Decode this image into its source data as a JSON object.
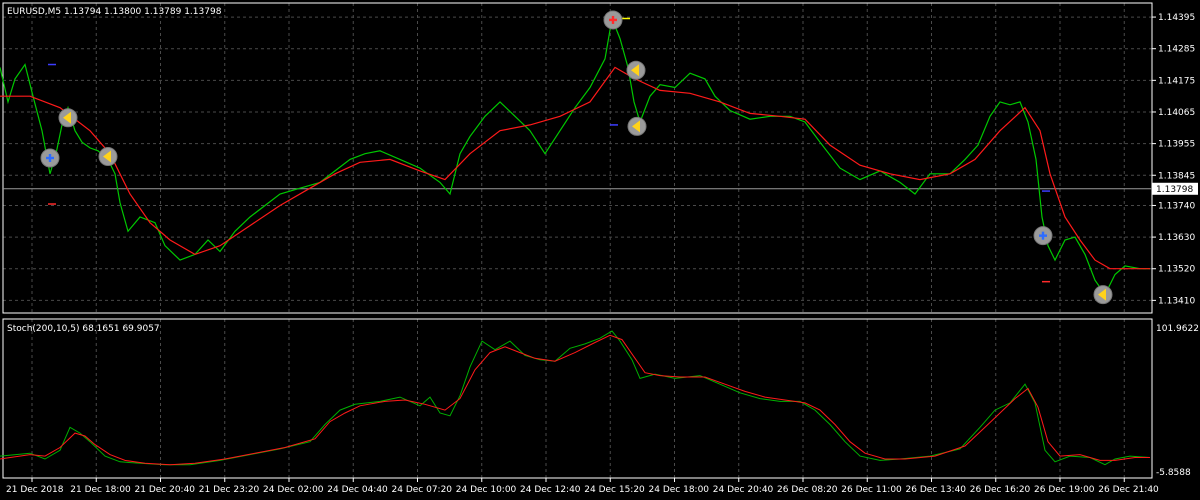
{
  "chart_data": {
    "type": "line",
    "symbol_label": "EURUSD,M5  1.13794 1.13800 1.13789 1.13798",
    "bid_line_label": "1.13798",
    "price_axis_ticks": [
      "1.14395",
      "1.14285",
      "1.14175",
      "1.14065",
      "1.13955",
      "1.13845",
      "1.13740",
      "1.13630",
      "1.13520",
      "1.13410"
    ],
    "price_range": [
      1.1338,
      1.1443
    ],
    "bid_price": 1.13798,
    "x_ticks": [
      "21 Dec 2018",
      "21 Dec 18:00",
      "21 Dec 20:40",
      "21 Dec 23:20",
      "24 Dec 02:00",
      "24 Dec 04:40",
      "24 Dec 07:20",
      "24 Dec 10:00",
      "24 Dec 12:40",
      "24 Dec 15:20",
      "24 Dec 18:00",
      "24 Dec 20:40",
      "26 Dec 08:20",
      "26 Dec 11:00",
      "26 Dec 13:40",
      "26 Dec 16:20",
      "26 Dec 19:00",
      "26 Dec 21:40"
    ],
    "x_range": [
      0,
      1150
    ],
    "price_path": [
      [
        0,
        1.1422
      ],
      [
        8,
        1.141
      ],
      [
        15,
        1.1418
      ],
      [
        25,
        1.1423
      ],
      [
        33,
        1.1412
      ],
      [
        42,
        1.14
      ],
      [
        50,
        1.1385
      ],
      [
        56,
        1.1392
      ],
      [
        62,
        1.1402
      ],
      [
        68,
        1.1408
      ],
      [
        75,
        1.14
      ],
      [
        82,
        1.1396
      ],
      [
        90,
        1.1394
      ],
      [
        98,
        1.1393
      ],
      [
        108,
        1.139
      ],
      [
        115,
        1.1385
      ],
      [
        120,
        1.1375
      ],
      [
        128,
        1.1365
      ],
      [
        140,
        1.137
      ],
      [
        155,
        1.1368
      ],
      [
        165,
        1.136
      ],
      [
        180,
        1.1355
      ],
      [
        195,
        1.1357
      ],
      [
        208,
        1.1362
      ],
      [
        220,
        1.1358
      ],
      [
        235,
        1.1365
      ],
      [
        250,
        1.137
      ],
      [
        265,
        1.1374
      ],
      [
        280,
        1.1378
      ],
      [
        300,
        1.138
      ],
      [
        320,
        1.1382
      ],
      [
        335,
        1.1386
      ],
      [
        350,
        1.139
      ],
      [
        365,
        1.1392
      ],
      [
        380,
        1.1393
      ],
      [
        400,
        1.139
      ],
      [
        420,
        1.1387
      ],
      [
        440,
        1.1382
      ],
      [
        450,
        1.1378
      ],
      [
        460,
        1.1392
      ],
      [
        470,
        1.1398
      ],
      [
        485,
        1.1405
      ],
      [
        500,
        1.141
      ],
      [
        515,
        1.1405
      ],
      [
        530,
        1.14
      ],
      [
        545,
        1.1392
      ],
      [
        560,
        1.14
      ],
      [
        575,
        1.1408
      ],
      [
        590,
        1.1415
      ],
      [
        605,
        1.1425
      ],
      [
        612,
        1.1439
      ],
      [
        620,
        1.1432
      ],
      [
        628,
        1.1422
      ],
      [
        634,
        1.141
      ],
      [
        640,
        1.1403
      ],
      [
        650,
        1.1412
      ],
      [
        660,
        1.1416
      ],
      [
        675,
        1.1415
      ],
      [
        690,
        1.142
      ],
      [
        705,
        1.1418
      ],
      [
        715,
        1.1412
      ],
      [
        730,
        1.1407
      ],
      [
        750,
        1.1404
      ],
      [
        770,
        1.1405
      ],
      [
        790,
        1.1405
      ],
      [
        805,
        1.1403
      ],
      [
        820,
        1.1396
      ],
      [
        840,
        1.1387
      ],
      [
        860,
        1.1383
      ],
      [
        880,
        1.1386
      ],
      [
        900,
        1.1382
      ],
      [
        915,
        1.1378
      ],
      [
        930,
        1.1385
      ],
      [
        950,
        1.1385
      ],
      [
        965,
        1.139
      ],
      [
        978,
        1.1395
      ],
      [
        990,
        1.1405
      ],
      [
        1000,
        1.141
      ],
      [
        1010,
        1.1409
      ],
      [
        1020,
        1.141
      ],
      [
        1028,
        1.1403
      ],
      [
        1036,
        1.139
      ],
      [
        1042,
        1.137
      ],
      [
        1048,
        1.136
      ],
      [
        1055,
        1.1355
      ],
      [
        1065,
        1.1362
      ],
      [
        1075,
        1.1363
      ],
      [
        1085,
        1.1357
      ],
      [
        1095,
        1.1348
      ],
      [
        1105,
        1.1343
      ],
      [
        1115,
        1.135
      ],
      [
        1125,
        1.1353
      ],
      [
        1140,
        1.1352
      ],
      [
        1150,
        1.1352
      ]
    ],
    "ma_path": [
      [
        0,
        1.1412
      ],
      [
        30,
        1.1412
      ],
      [
        60,
        1.1408
      ],
      [
        90,
        1.14
      ],
      [
        110,
        1.1392
      ],
      [
        130,
        1.1378
      ],
      [
        150,
        1.1368
      ],
      [
        170,
        1.1362
      ],
      [
        195,
        1.1357
      ],
      [
        220,
        1.136
      ],
      [
        250,
        1.1367
      ],
      [
        280,
        1.1374
      ],
      [
        310,
        1.138
      ],
      [
        335,
        1.1385
      ],
      [
        360,
        1.1389
      ],
      [
        390,
        1.139
      ],
      [
        420,
        1.1386
      ],
      [
        445,
        1.1383
      ],
      [
        470,
        1.1392
      ],
      [
        500,
        1.14
      ],
      [
        530,
        1.1402
      ],
      [
        560,
        1.1405
      ],
      [
        590,
        1.141
      ],
      [
        615,
        1.1422
      ],
      [
        635,
        1.1418
      ],
      [
        660,
        1.1414
      ],
      [
        690,
        1.1413
      ],
      [
        720,
        1.141
      ],
      [
        750,
        1.1406
      ],
      [
        780,
        1.1405
      ],
      [
        805,
        1.1404
      ],
      [
        830,
        1.1395
      ],
      [
        860,
        1.1388
      ],
      [
        890,
        1.1385
      ],
      [
        920,
        1.1383
      ],
      [
        950,
        1.1385
      ],
      [
        975,
        1.139
      ],
      [
        1000,
        1.14
      ],
      [
        1025,
        1.1408
      ],
      [
        1040,
        1.14
      ],
      [
        1050,
        1.1385
      ],
      [
        1065,
        1.137
      ],
      [
        1080,
        1.1362
      ],
      [
        1095,
        1.1355
      ],
      [
        1110,
        1.1352
      ],
      [
        1130,
        1.1352
      ],
      [
        1150,
        1.1352
      ]
    ],
    "signals": [
      {
        "x": 50,
        "price": 1.13905,
        "kind": "buy"
      },
      {
        "x": 68,
        "price": 1.14045,
        "kind": "close"
      },
      {
        "x": 108,
        "price": 1.1391,
        "kind": "close"
      },
      {
        "x": 613,
        "price": 1.14385,
        "kind": "sell"
      },
      {
        "x": 636,
        "price": 1.1421,
        "kind": "close"
      },
      {
        "x": 637,
        "price": 1.14015,
        "kind": "close"
      },
      {
        "x": 1043,
        "price": 1.13635,
        "kind": "buy"
      },
      {
        "x": 1103,
        "price": 1.1343,
        "kind": "close"
      }
    ],
    "stop_marks": [
      {
        "x": 52,
        "price": 1.1423,
        "color": "#3c3cff"
      },
      {
        "x": 52,
        "price": 1.13745,
        "color": "#ff2a2a"
      },
      {
        "x": 626,
        "price": 1.1439,
        "color": "#ffff00"
      },
      {
        "x": 614,
        "price": 1.1402,
        "color": "#3c3cff"
      },
      {
        "x": 1046,
        "price": 1.1379,
        "color": "#3c3cff"
      },
      {
        "x": 1046,
        "price": 1.13475,
        "color": "#ff2a2a"
      }
    ],
    "stoch_label": "Stoch(200,10,5) 68.1651 69.9057",
    "stoch_axis_top": "101.9622",
    "stoch_axis_bottom": "-5.8588",
    "stoch_range": [
      -5.8588,
      101.9622
    ],
    "stoch_main": [
      [
        0,
        8
      ],
      [
        30,
        10
      ],
      [
        45,
        6
      ],
      [
        60,
        12
      ],
      [
        70,
        28
      ],
      [
        80,
        24
      ],
      [
        90,
        18
      ],
      [
        105,
        8
      ],
      [
        120,
        4
      ],
      [
        140,
        3
      ],
      [
        165,
        2
      ],
      [
        190,
        2
      ],
      [
        220,
        5
      ],
      [
        250,
        9
      ],
      [
        280,
        13
      ],
      [
        310,
        18
      ],
      [
        325,
        30
      ],
      [
        340,
        40
      ],
      [
        355,
        44
      ],
      [
        380,
        46
      ],
      [
        400,
        49
      ],
      [
        420,
        43
      ],
      [
        430,
        49
      ],
      [
        440,
        38
      ],
      [
        450,
        36
      ],
      [
        460,
        50
      ],
      [
        470,
        70
      ],
      [
        482,
        88
      ],
      [
        495,
        82
      ],
      [
        510,
        88
      ],
      [
        525,
        78
      ],
      [
        540,
        75
      ],
      [
        555,
        74
      ],
      [
        570,
        83
      ],
      [
        585,
        86
      ],
      [
        600,
        90
      ],
      [
        612,
        95
      ],
      [
        620,
        88
      ],
      [
        632,
        75
      ],
      [
        640,
        62
      ],
      [
        655,
        65
      ],
      [
        675,
        62
      ],
      [
        700,
        64
      ],
      [
        720,
        58
      ],
      [
        740,
        52
      ],
      [
        760,
        48
      ],
      [
        780,
        46
      ],
      [
        800,
        46
      ],
      [
        815,
        40
      ],
      [
        830,
        30
      ],
      [
        845,
        18
      ],
      [
        860,
        8
      ],
      [
        880,
        5
      ],
      [
        900,
        6
      ],
      [
        930,
        8
      ],
      [
        960,
        13
      ],
      [
        980,
        28
      ],
      [
        995,
        40
      ],
      [
        1010,
        45
      ],
      [
        1025,
        58
      ],
      [
        1035,
        45
      ],
      [
        1045,
        12
      ],
      [
        1055,
        4
      ],
      [
        1070,
        8
      ],
      [
        1090,
        7
      ],
      [
        1105,
        2
      ],
      [
        1115,
        6
      ],
      [
        1130,
        8
      ],
      [
        1150,
        7
      ]
    ],
    "stoch_signal": [
      [
        0,
        6
      ],
      [
        30,
        9
      ],
      [
        45,
        8
      ],
      [
        60,
        14
      ],
      [
        75,
        24
      ],
      [
        85,
        22
      ],
      [
        95,
        16
      ],
      [
        110,
        9
      ],
      [
        125,
        5
      ],
      [
        145,
        3
      ],
      [
        170,
        2
      ],
      [
        195,
        3
      ],
      [
        225,
        6
      ],
      [
        255,
        10
      ],
      [
        285,
        14
      ],
      [
        315,
        20
      ],
      [
        330,
        32
      ],
      [
        345,
        38
      ],
      [
        360,
        43
      ],
      [
        385,
        46
      ],
      [
        405,
        47
      ],
      [
        425,
        44
      ],
      [
        445,
        40
      ],
      [
        460,
        48
      ],
      [
        475,
        68
      ],
      [
        490,
        80
      ],
      [
        505,
        84
      ],
      [
        520,
        80
      ],
      [
        535,
        76
      ],
      [
        555,
        74
      ],
      [
        575,
        80
      ],
      [
        595,
        87
      ],
      [
        610,
        92
      ],
      [
        622,
        89
      ],
      [
        635,
        76
      ],
      [
        645,
        66
      ],
      [
        660,
        64
      ],
      [
        680,
        63
      ],
      [
        705,
        63
      ],
      [
        725,
        58
      ],
      [
        745,
        53
      ],
      [
        765,
        49
      ],
      [
        785,
        47
      ],
      [
        805,
        45
      ],
      [
        820,
        40
      ],
      [
        835,
        30
      ],
      [
        850,
        18
      ],
      [
        865,
        10
      ],
      [
        885,
        6
      ],
      [
        905,
        6
      ],
      [
        935,
        8
      ],
      [
        965,
        15
      ],
      [
        985,
        28
      ],
      [
        1000,
        38
      ],
      [
        1015,
        48
      ],
      [
        1028,
        55
      ],
      [
        1038,
        42
      ],
      [
        1048,
        18
      ],
      [
        1060,
        8
      ],
      [
        1080,
        9
      ],
      [
        1100,
        5
      ],
      [
        1115,
        5
      ],
      [
        1135,
        7
      ],
      [
        1150,
        7
      ]
    ],
    "colors": {
      "background": "#000000",
      "grid": "#4a4a4a",
      "axis": "#ffffff",
      "price": "#00c800",
      "ma": "#ff1a1a",
      "stoch_main": "#00b000",
      "stoch_signal": "#ff1a1a",
      "buy_signal": "#2d6cff",
      "sell_signal": "#ff2a2a",
      "close_signal": "#ffd21a"
    }
  }
}
